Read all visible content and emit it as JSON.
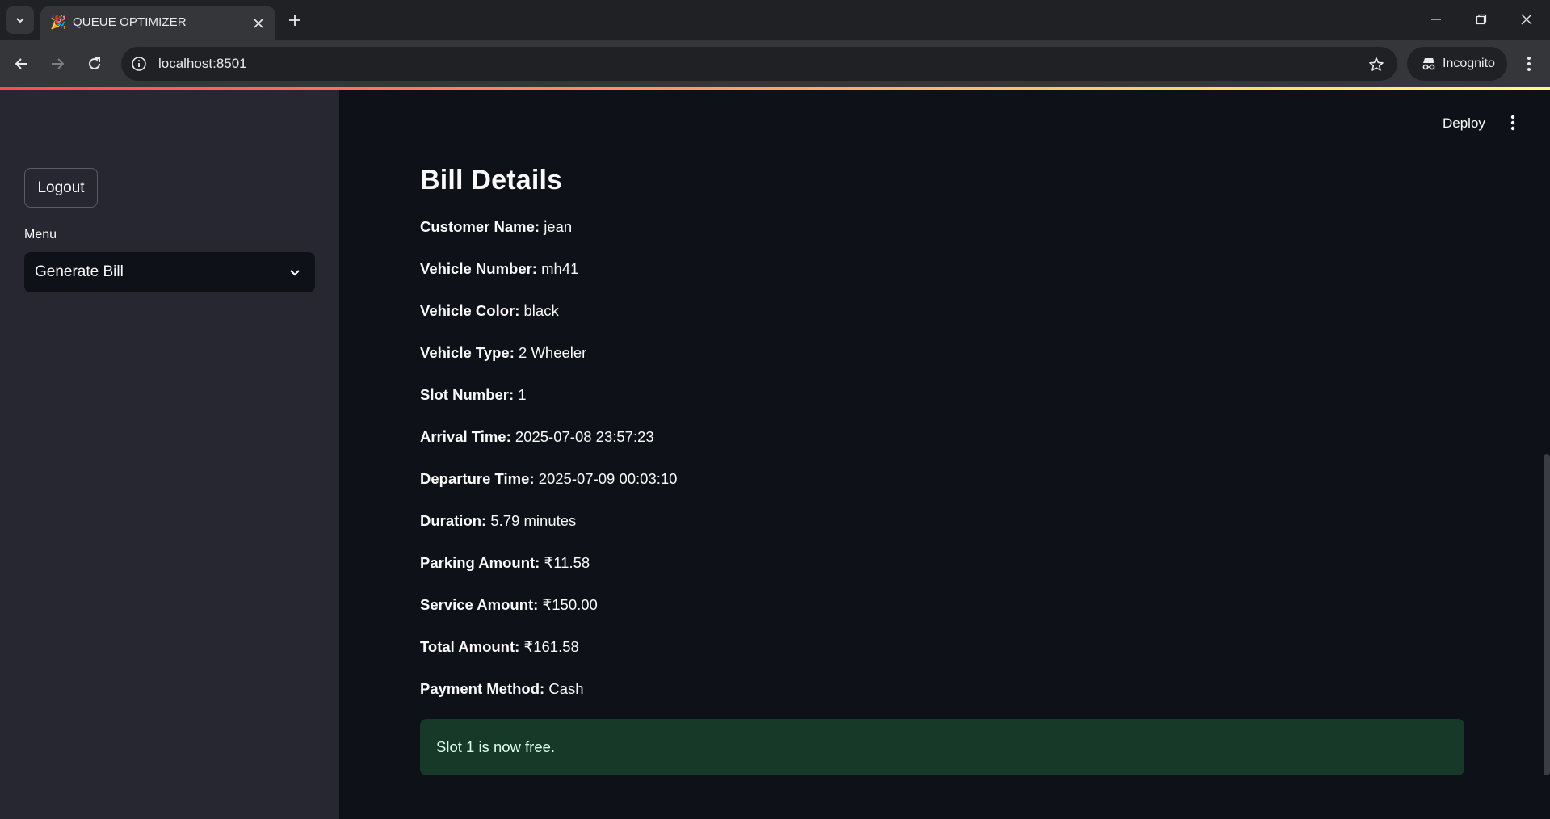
{
  "browser": {
    "tab_title": "QUEUE OPTIMIZER",
    "favicon": "🎉",
    "url": "localhost:8501",
    "incognito_label": "Incognito"
  },
  "app": {
    "deploy_label": "Deploy",
    "sidebar": {
      "logout_label": "Logout",
      "menu_label": "Menu",
      "menu_selected": "Generate Bill"
    },
    "bill": {
      "title": "Bill Details",
      "fields": [
        {
          "label": "Customer Name:",
          "value": "jean"
        },
        {
          "label": "Vehicle Number:",
          "value": "mh41"
        },
        {
          "label": "Vehicle Color:",
          "value": "black"
        },
        {
          "label": "Vehicle Type:",
          "value": "2 Wheeler"
        },
        {
          "label": "Slot Number:",
          "value": "1"
        },
        {
          "label": "Arrival Time:",
          "value": "2025-07-08 23:57:23"
        },
        {
          "label": "Departure Time:",
          "value": "2025-07-09 00:03:10"
        },
        {
          "label": "Duration:",
          "value": "5.79 minutes"
        },
        {
          "label": "Parking Amount:",
          "value": "₹11.58"
        },
        {
          "label": "Service Amount:",
          "value": "₹150.00"
        },
        {
          "label": "Total Amount:",
          "value": "₹161.58"
        },
        {
          "label": "Payment Method:",
          "value": "Cash"
        }
      ]
    },
    "success_message": "Slot 1 is now free."
  },
  "colors": {
    "app_bg": "#0e1117",
    "sidebar_bg": "#262730",
    "success_bg": "#173928",
    "success_text": "#dffde9",
    "accent_gradient_start": "#ff4b4b",
    "accent_gradient_end": "#fffd80"
  }
}
